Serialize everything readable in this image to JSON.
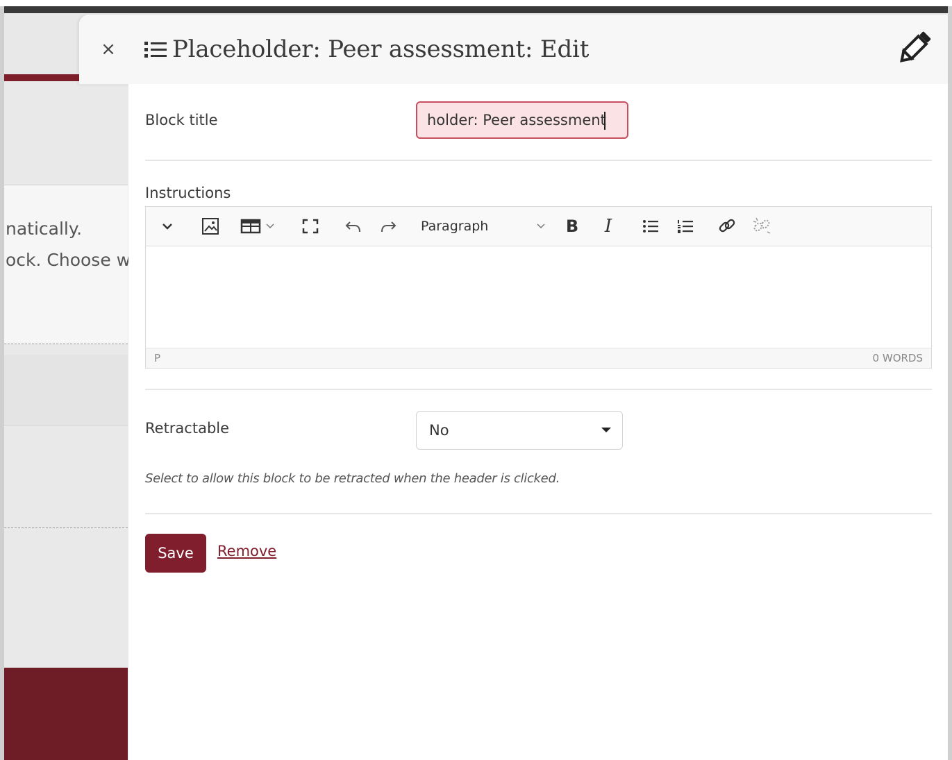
{
  "background": {
    "text_line_1": "natically.",
    "text_line_2": "ock. Choose w",
    "accent_color": "#7d1f2b"
  },
  "modal": {
    "close_label": "×",
    "title": "Placeholder: Peer assessment: Edit",
    "title_icon": "list-icon",
    "edit_icon": "pencil-icon"
  },
  "form": {
    "block_title_label": "Block title",
    "block_title_value": "holder: Peer assessment",
    "instructions_label": "Instructions",
    "editor": {
      "toolbar": {
        "collapse_icon": "chevron-down-icon",
        "image_icon": "image-icon",
        "table_icon": "table-icon",
        "fullscreen_icon": "fullscreen-icon",
        "undo_icon": "undo-icon",
        "redo_icon": "redo-icon",
        "block_format": "Paragraph",
        "bold_label": "B",
        "italic_label": "I",
        "bullet_list_icon": "bullet-list-icon",
        "numbered_list_icon": "numbered-list-icon",
        "link_icon": "link-icon",
        "unlink_icon": "unlink-icon"
      },
      "status_path": "P",
      "word_count": "0 WORDS"
    },
    "retractable_label": "Retractable",
    "retractable_value": "No",
    "retractable_help": "Select to allow this block to be retracted when the header is clicked.",
    "save_label": "Save",
    "remove_label": "Remove"
  },
  "colors": {
    "primary": "#801e2d",
    "input_error_bg": "#fbe3e5",
    "input_error_border": "#c8505e"
  }
}
